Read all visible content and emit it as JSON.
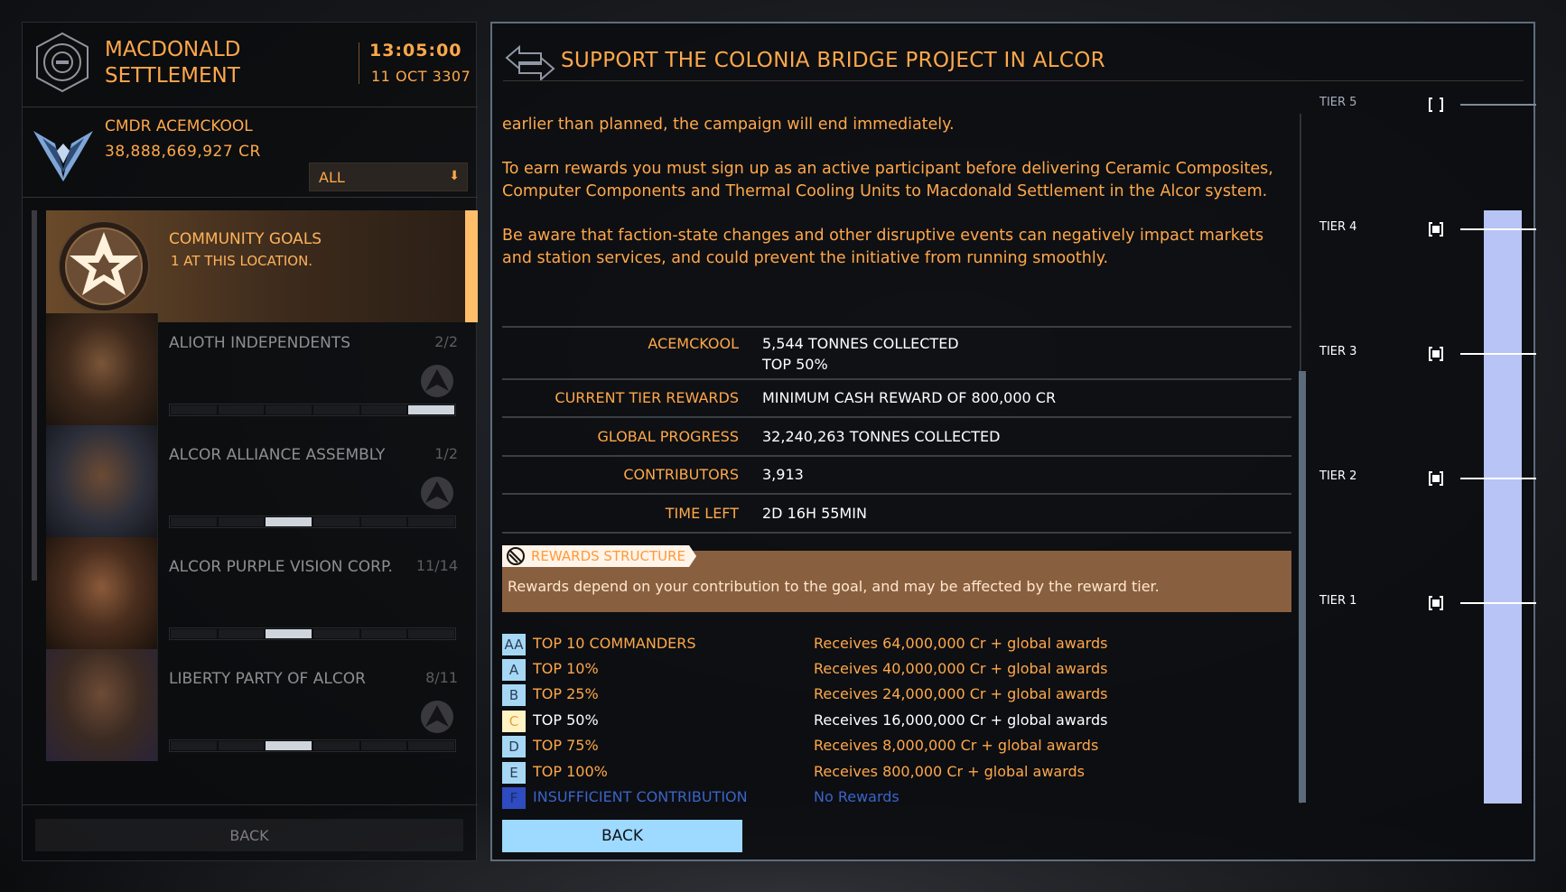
{
  "header": {
    "station_name": "MACDONALD SETTLEMENT",
    "time": "13:05:00",
    "date": "11 OCT 3307",
    "cmdr_name": "CMDR ACEMCKOOL",
    "credits": "38,888,669,927 CR",
    "filter_value": "ALL"
  },
  "list": {
    "community_goals": {
      "title": "COMMUNITY GOALS",
      "subtitle": "1 AT THIS LOCATION."
    },
    "factions": [
      {
        "name": "ALIOTH INDEPENDENTS",
        "count": "2/2",
        "progress_segments": 6,
        "progress_filled": 6
      },
      {
        "name": "ALCOR ALLIANCE ASSEMBLY",
        "count": "1/2",
        "progress_segments": 6,
        "progress_filled": 3
      },
      {
        "name": "ALCOR PURPLE VISION CORP.",
        "count": "11/14",
        "progress_segments": 6,
        "progress_filled": 3
      },
      {
        "name": "LIBERTY PARTY OF ALCOR",
        "count": "8/11",
        "progress_segments": 6,
        "progress_filled": 3
      }
    ],
    "back_label": "BACK"
  },
  "detail": {
    "title": "SUPPORT THE COLONIA BRIDGE PROJECT IN ALCOR",
    "paragraphs": [
      "earlier than planned, the campaign will end immediately.",
      "To earn rewards you must sign up as an active participant before delivering Ceramic Composites, Computer Components and Thermal Cooling Units to Macdonald Settlement in the Alcor system.",
      "Be aware that faction-state changes and other disruptive events can negatively impact markets and station services, and could prevent the initiative from running smoothly."
    ],
    "stats": [
      {
        "label": "ACEMCKOOL",
        "value": "5,544 TONNES COLLECTED",
        "value2": "TOP 50%"
      },
      {
        "label": "CURRENT TIER REWARDS",
        "value": "MINIMUM CASH REWARD OF 800,000 CR"
      },
      {
        "label": "GLOBAL PROGRESS",
        "value": "32,240,263 TONNES COLLECTED"
      },
      {
        "label": "CONTRIBUTORS",
        "value": "3,913"
      },
      {
        "label": "TIME LEFT",
        "value": "2D 16H 55MIN"
      }
    ],
    "rewards_structure": {
      "tab": "REWARDS STRUCTURE",
      "note": "Rewards depend on your contribution to the goal, and may be affected by the reward tier."
    },
    "tiers": [
      {
        "code": "AA",
        "rank": "TOP 10 COMMANDERS",
        "reward": "Receives 64,000,000 Cr + global awards",
        "code_bg": "#a6d8f5"
      },
      {
        "code": "A",
        "rank": "TOP 10%",
        "reward": "Receives 40,000,000 Cr + global awards",
        "code_bg": "#a6d8f5"
      },
      {
        "code": "B",
        "rank": "TOP 25%",
        "reward": "Receives 24,000,000 Cr + global awards",
        "code_bg": "#a6d8f5"
      },
      {
        "code": "C",
        "rank": "TOP 50%",
        "reward": "Receives 16,000,000 Cr + global awards",
        "code_bg": "#fff3c4",
        "highlight": true
      },
      {
        "code": "D",
        "rank": "TOP 75%",
        "reward": "Receives 8,000,000 Cr + global awards",
        "code_bg": "#a6d8f5"
      },
      {
        "code": "E",
        "rank": "TOP 100%",
        "reward": "Receives 800,000 Cr + global awards",
        "code_bg": "#a6d8f5"
      },
      {
        "code": "F",
        "rank": "INSUFFICIENT CONTRIBUTION",
        "reward": "No Rewards",
        "code_bg": "#2e4bc0",
        "muted": true
      }
    ],
    "back_label": "BACK",
    "tier_meter": {
      "labels": [
        "TIER 5",
        "TIER 4",
        "TIER 3",
        "TIER 2",
        "TIER 1"
      ],
      "reached": [
        false,
        true,
        true,
        true,
        true
      ],
      "fill_fraction": 0.86
    }
  },
  "colors": {
    "accent_orange": "#ffa84a",
    "accent_blue": "#9ed9ff",
    "meter_blue": "#b7c4f5"
  }
}
